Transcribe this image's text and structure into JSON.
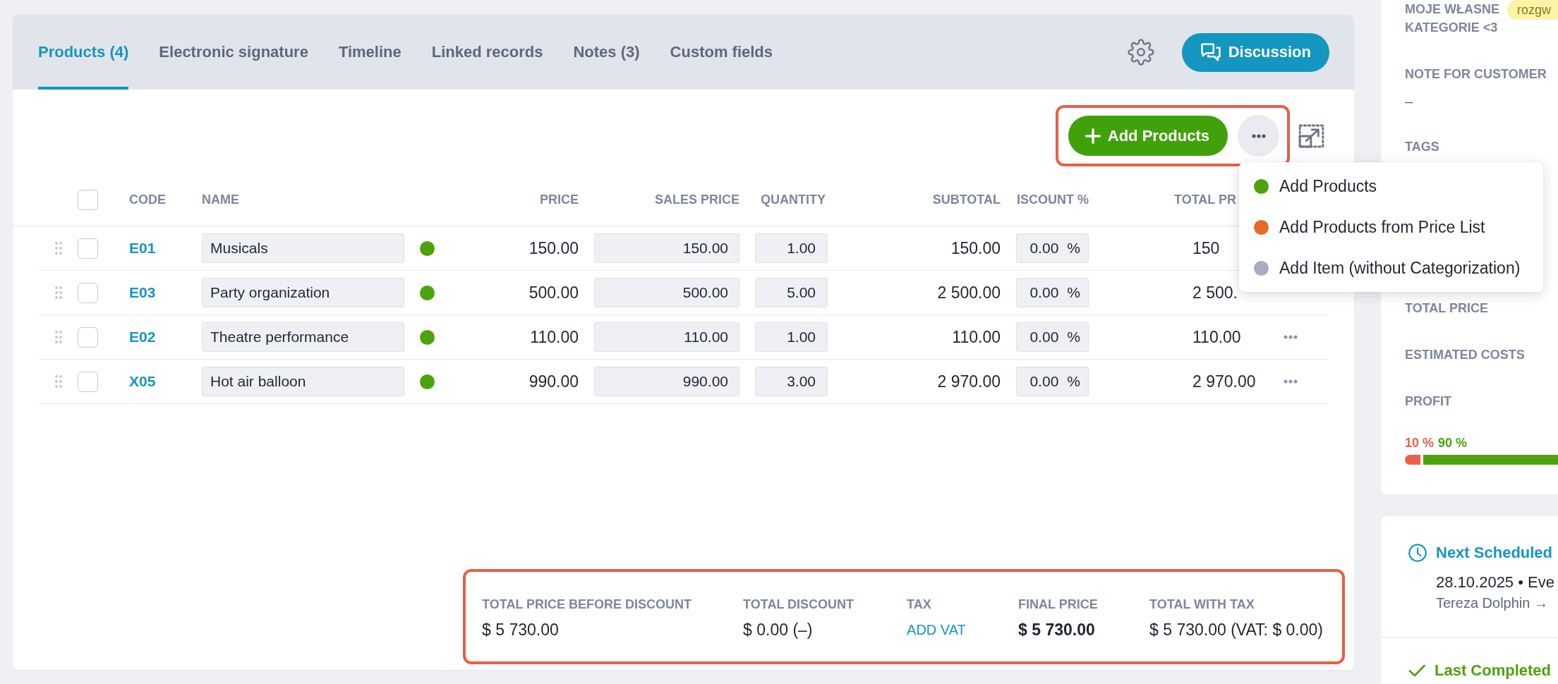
{
  "tabs": [
    {
      "label": "Products (4)",
      "selected": true
    },
    {
      "label": "Electronic signature",
      "selected": false
    },
    {
      "label": "Timeline",
      "selected": false
    },
    {
      "label": "Linked records",
      "selected": false
    },
    {
      "label": "Notes (3)",
      "selected": false
    },
    {
      "label": "Custom fields",
      "selected": false
    }
  ],
  "discussion_button": {
    "label": "Discussion"
  },
  "toolbar": {
    "highlighted": true,
    "add_button": "Add Products"
  },
  "add_menu": {
    "items": [
      {
        "label": "Add Products",
        "color": "#4ea20b"
      },
      {
        "label": "Add Products from Price List",
        "color": "#e46b25"
      },
      {
        "label": "Add Item (without Categorization)",
        "color": "#a7acc0"
      }
    ]
  },
  "table": {
    "select_all": false,
    "columns": [
      "CODE",
      "NAME",
      "PRICE",
      "SALES PRICE",
      "QUANTITY",
      "SUBTOTAL",
      "ISCOUNT %",
      "TOTAL PR"
    ],
    "rows": [
      {
        "checked": false,
        "code": "E01",
        "name": "Musicals",
        "color": "#4ea20b",
        "price": "150.00",
        "sales_price": "150.00",
        "quantity": "1.00",
        "subtotal": "150.00",
        "discount": "0.00",
        "discount_unit": "%",
        "total": "150",
        "menu_button": false
      },
      {
        "checked": false,
        "code": "E03",
        "name": "Party organization",
        "color": "#4ea20b",
        "price": "500.00",
        "sales_price": "500.00",
        "quantity": "5.00",
        "subtotal": "2 500.00",
        "discount": "0.00",
        "discount_unit": "%",
        "total": "2 500.",
        "menu_button": false
      },
      {
        "checked": false,
        "code": "E02",
        "name": "Theatre performance",
        "color": "#4ea20b",
        "price": "110.00",
        "sales_price": "110.00",
        "quantity": "1.00",
        "subtotal": "110.00",
        "discount": "0.00",
        "discount_unit": "%",
        "total": "110.00",
        "menu_button": true
      },
      {
        "checked": false,
        "code": "X05",
        "name": "Hot air balloon",
        "color": "#4ea20b",
        "price": "990.00",
        "sales_price": "990.00",
        "quantity": "3.00",
        "subtotal": "2 970.00",
        "discount": "0.00",
        "discount_unit": "%",
        "total": "2 970.00",
        "menu_button": true
      }
    ]
  },
  "totals": {
    "highlighted": true,
    "items": [
      {
        "kind": "text",
        "label": "TOTAL PRICE BEFORE DISCOUNT",
        "value": "$ 5 730.00"
      },
      {
        "kind": "text",
        "label": "TOTAL DISCOUNT",
        "value": "$ 0.00 (–)"
      },
      {
        "kind": "link",
        "label": "TAX",
        "value": "ADD VAT"
      },
      {
        "kind": "strong",
        "label": "FINAL PRICE",
        "value": "$ 5 730.00"
      },
      {
        "kind": "text",
        "label": "TOTAL WITH TAX",
        "value": "$ 5 730.00 (VAT: $ 0.00)"
      }
    ]
  },
  "sidebar": {
    "fields": [
      {
        "label": "MOJE WŁASNE KATEGORIE <3",
        "tag": "rozgw"
      },
      {
        "label": "NOTE FOR CUSTOMER",
        "value": "–"
      },
      {
        "label": "TAGS"
      }
    ],
    "price_summary": [
      {
        "label": "TOTAL PRICE"
      },
      {
        "label": "ESTIMATED COSTS"
      },
      {
        "label": "PROFIT"
      }
    ],
    "profit_bar": {
      "cost_percent": "10 %",
      "profit_percent": "90 %",
      "level": 0.9
    },
    "next_activity": {
      "title": "Next Scheduled",
      "detail": "28.10.2025 • Eve",
      "person": "Tereza Dolphin →"
    },
    "last_activity": {
      "title": "Last Completed"
    }
  }
}
